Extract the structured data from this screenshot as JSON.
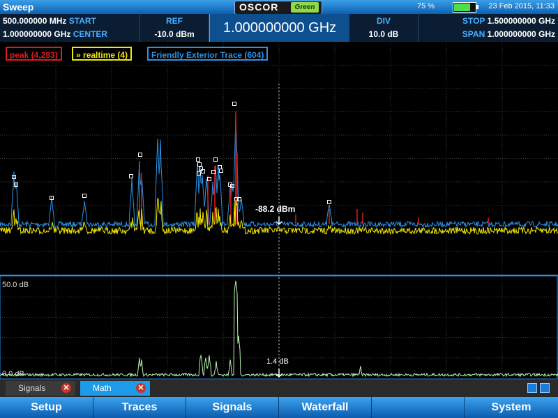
{
  "titlebar": {
    "title": "Sweep",
    "logo_text": "OSCOR",
    "logo_badge": "Green",
    "battery_pct": "75 %",
    "battery_level": 0.75,
    "datetime": "23 Feb 2015, 11:33"
  },
  "header": {
    "start_value": "500.000000 MHz",
    "start_label": "START",
    "center_value": "1.000000000 GHz",
    "center_label": "CENTER",
    "ref_label": "REF",
    "ref_value": "-10.0 dBm",
    "main_freq": "1.000000000 GHz",
    "div_label": "DIV",
    "div_value": "10.0 dB",
    "stop_label": "STOP",
    "stop_value": "1.500000000 GHz",
    "span_label": "SPAN",
    "span_value": "1.000000000 GHz"
  },
  "legend": {
    "peak": "peak (4,283)",
    "realtime": "realtime (4)",
    "realtime_marker": "»",
    "friendly": "Friendly Exterior Trace (604)"
  },
  "plot": {
    "marker_label": "-88.2 dBm",
    "math_scale_top": "50.0 dB",
    "math_scale_bottom": "0.0 dB",
    "math_marker_label": "1.4 dB"
  },
  "colors": {
    "peak": "#e31a1a",
    "realtime": "#f2ea00",
    "friendly": "#2a93e8",
    "math": "#b9f5b0",
    "accent": "#1e9be8"
  },
  "tabs": [
    {
      "label": "Signals",
      "close_icon": "close-icon"
    },
    {
      "label": "Math",
      "close_icon": "close-icon"
    }
  ],
  "menu": [
    "Setup",
    "Traces",
    "Signals",
    "Waterfall",
    "",
    "System"
  ]
}
